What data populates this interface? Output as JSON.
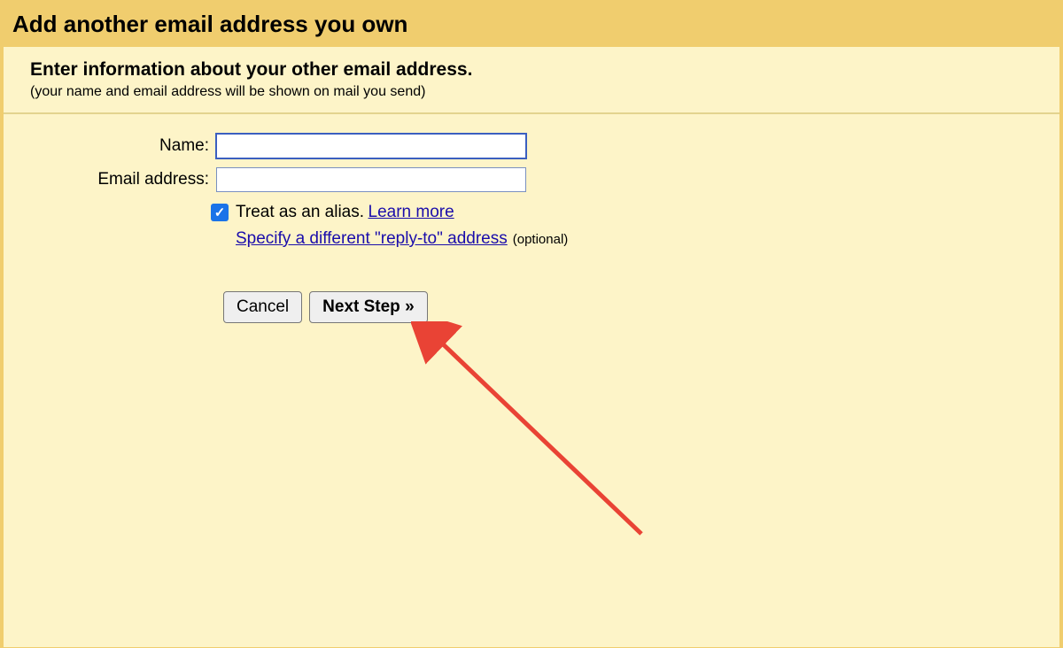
{
  "title": "Add another email address you own",
  "section": {
    "title": "Enter information about your other email address.",
    "subtitle": "(your name and email address will be shown on mail you send)"
  },
  "form": {
    "name_label": "Name:",
    "name_value": "",
    "email_label": "Email address:",
    "email_value": "",
    "alias_checked": true,
    "alias_text": "Treat as an alias.",
    "learn_more": "Learn more",
    "reply_to_link": "Specify a different \"reply-to\" address",
    "optional_text": "(optional)"
  },
  "buttons": {
    "cancel": "Cancel",
    "next": "Next Step »"
  }
}
